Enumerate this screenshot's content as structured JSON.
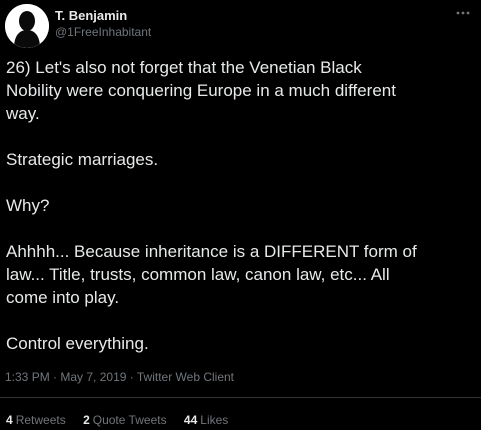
{
  "author": {
    "display_name": "T. Benjamin",
    "handle": "@1FreeInhabitant",
    "avatar_icon": "profile-silhouette-icon"
  },
  "more_icon": "more-dots-icon",
  "tweet": {
    "text": "26) Let's also not forget that the Venetian Black\nNobility were conquering Europe in a much different\nway.\n\nStrategic marriages.\n\nWhy?\n\nAhhhh... Because inheritance is a DIFFERENT form of\nlaw... Title, trusts, common law, canon law, etc... All\ncome into play.\n\nControl everything."
  },
  "meta": {
    "time": "1:33 PM",
    "separator": " · ",
    "date": "May 7, 2019",
    "client": "Twitter Web Client"
  },
  "stats": {
    "retweets_count": "4",
    "retweets_label": "Retweets",
    "quote_count": "2",
    "quote_label": "Quote Tweets",
    "likes_count": "44",
    "likes_label": "Likes"
  },
  "colors": {
    "background": "#000000",
    "primary_text": "#e7e9ea",
    "secondary_text": "#71767b",
    "divider": "#2f3336"
  }
}
